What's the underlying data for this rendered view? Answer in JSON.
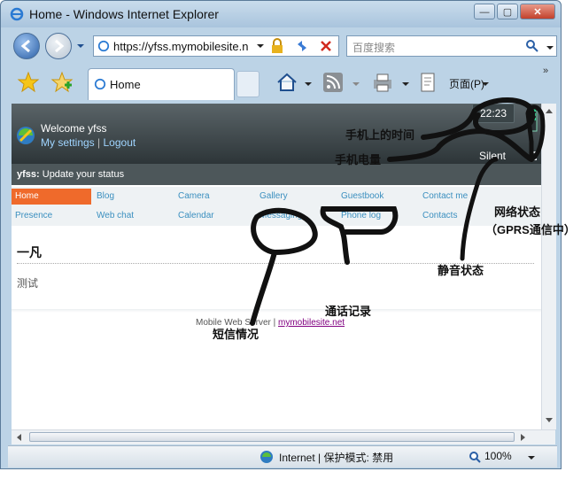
{
  "window": {
    "title": "Home - Windows Internet Explorer"
  },
  "address": {
    "url": "https://yfss.mymobilesite.n"
  },
  "search": {
    "placeholder": "百度搜索"
  },
  "tab": {
    "label": "Home"
  },
  "toolbar": {
    "page_menu": "页面(P)"
  },
  "page": {
    "welcome": "Welcome yfss",
    "my_settings": "My settings",
    "separator": "|",
    "logout": "Logout",
    "time": "22:23",
    "silent": "Silent",
    "status_user": "yfss:",
    "status_prompt": "Update your status",
    "nav": [
      {
        "label": "Home"
      },
      {
        "label": "Blog"
      },
      {
        "label": "Camera"
      },
      {
        "label": "Gallery"
      },
      {
        "label": "Guestbook"
      },
      {
        "label": "Contact me"
      },
      {
        "label": "Presence"
      },
      {
        "label": "Web chat"
      },
      {
        "label": "Calendar"
      },
      {
        "label": "Messaging"
      },
      {
        "label": "Phone log"
      },
      {
        "label": "Contacts"
      }
    ],
    "heading": "一凡",
    "body_text": "测试",
    "footer_text": "Mobile Web Server |",
    "footer_link": "mymobilesite.net"
  },
  "statusbar": {
    "zone": "Internet | 保护模式: 禁用",
    "zoom": "100%"
  },
  "annotations": {
    "phone_time": "手机上的时间",
    "battery": "手机电量",
    "network": "网络状态",
    "gprs": "（GPRS通信中）",
    "silent_state": "静音状态",
    "call_log": "通话记录",
    "sms": "短信情况"
  },
  "colors": {
    "accent_orange": "#ef6a2b",
    "link_blue": "#3a8fbf",
    "header_dark": "#2d3538"
  }
}
